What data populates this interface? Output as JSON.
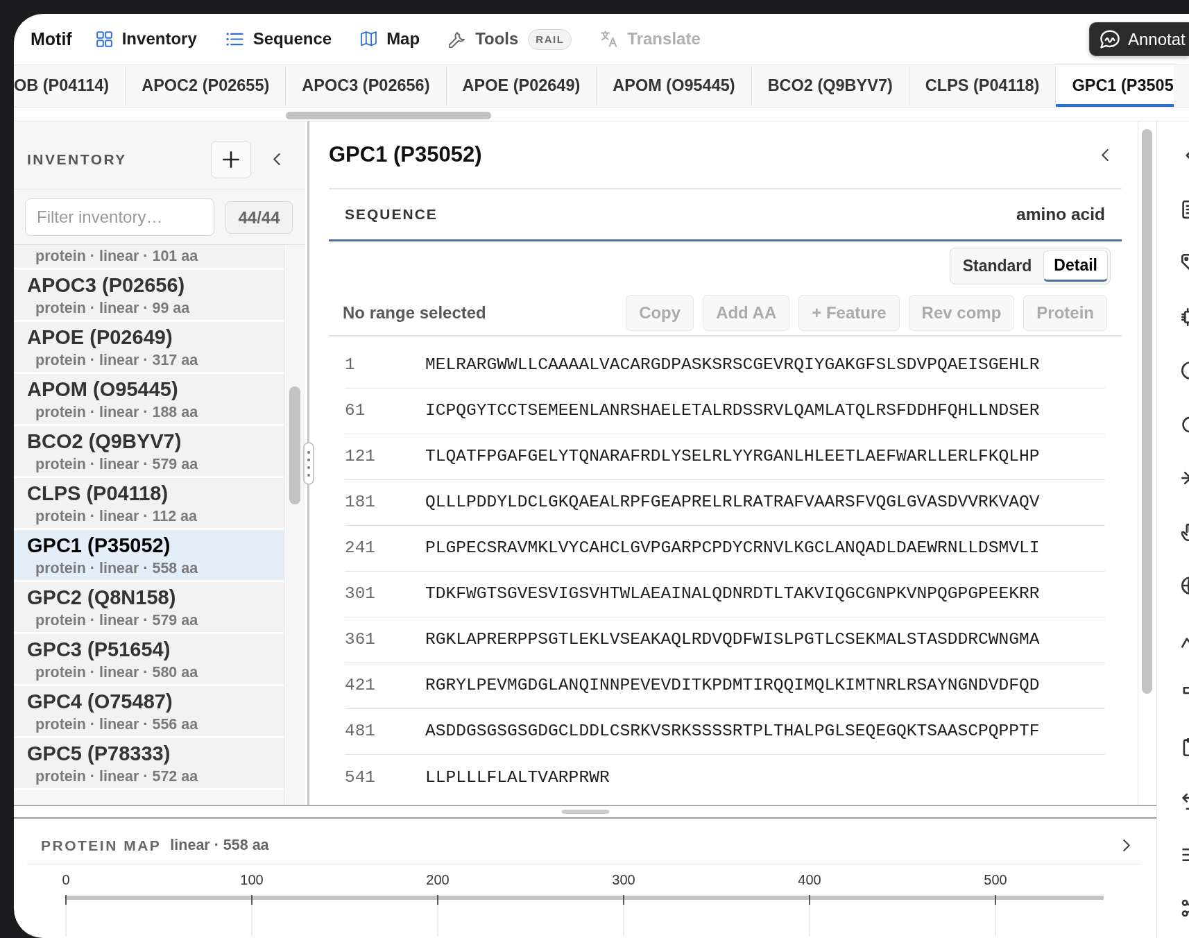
{
  "brand": "Motif",
  "nav": [
    {
      "label": "Inventory",
      "kind": "view",
      "disabled": false
    },
    {
      "label": "Sequence",
      "kind": "view",
      "disabled": false
    },
    {
      "label": "Map",
      "kind": "view",
      "disabled": false
    },
    {
      "label": "Tools",
      "kind": "menu",
      "disabled": false,
      "badge": "RAIL"
    },
    {
      "label": "Translate",
      "kind": "view",
      "disabled": true
    }
  ],
  "annotate_button": {
    "label": "Annotat"
  },
  "tabs": [
    {
      "label": "OB (P04114)",
      "selected": false
    },
    {
      "label": "APOC2 (P02655)",
      "selected": false
    },
    {
      "label": "APOC3 (P02656)",
      "selected": false
    },
    {
      "label": "APOE (P02649)",
      "selected": false
    },
    {
      "label": "APOM (O95445)",
      "selected": false
    },
    {
      "label": "BCO2 (Q9BYV7)",
      "selected": false
    },
    {
      "label": "CLPS (P04118)",
      "selected": false
    },
    {
      "label": "GPC1 (P3505",
      "selected": true
    }
  ],
  "sidebar": {
    "title": "INVENTORY",
    "filter": {
      "placeholder": "Filter inventory…"
    },
    "count": "44/44",
    "items": [
      {
        "meta": "protein · linear · 101 aa",
        "selected": false
      },
      {
        "title": "APOC3 (P02656)",
        "meta": "protein · linear · 99 aa",
        "selected": false
      },
      {
        "title": "APOE (P02649)",
        "meta": "protein · linear · 317 aa",
        "selected": false
      },
      {
        "title": "APOM (O95445)",
        "meta": "protein · linear · 188 aa",
        "selected": false
      },
      {
        "title": "BCO2 (Q9BYV7)",
        "meta": "protein · linear · 579 aa",
        "selected": false
      },
      {
        "title": "CLPS (P04118)",
        "meta": "protein · linear · 112 aa",
        "selected": false
      },
      {
        "title": "GPC1 (P35052)",
        "meta": "protein · linear · 558 aa",
        "selected": true
      },
      {
        "title": "GPC2 (Q8N158)",
        "meta": "protein · linear · 579 aa",
        "selected": false
      },
      {
        "title": "GPC3 (P51654)",
        "meta": "protein · linear · 580 aa",
        "selected": false
      },
      {
        "title": "GPC4 (O75487)",
        "meta": "protein · linear · 556 aa",
        "selected": false
      },
      {
        "title": "GPC5 (P78333)",
        "meta": "protein · linear · 572 aa",
        "selected": false
      }
    ]
  },
  "editor": {
    "title": "GPC1 (P35052)",
    "section": "SEQUENCE",
    "alphabet": "amino acid",
    "views": [
      {
        "label": "Standard",
        "selected": false
      },
      {
        "label": "Detail",
        "selected": true
      }
    ],
    "selection": "No range selected",
    "actions": [
      {
        "label": "Copy",
        "disabled": true
      },
      {
        "label": "Add AA",
        "disabled": true
      },
      {
        "label": "+ Feature",
        "disabled": true
      },
      {
        "label": "Rev comp",
        "disabled": true
      },
      {
        "label": "Protein",
        "disabled": true
      }
    ],
    "rows": [
      {
        "start": "1",
        "residues": "MELRARGWWLLCAAAALVACARGDPASKSRSCGEVRQIYGAKGFSLSDVPQAEISGEHLR"
      },
      {
        "start": "61",
        "residues": "ICPQGYTCCTSEMEENLANRSHAELETALRDSSRVLQAMLATQLRSFDDHFQHLLNDSER"
      },
      {
        "start": "121",
        "residues": "TLQATFPGAFGELYTQNARAFRDLYSELRLYYRGANLHLEETLAEFWARLLERLFKQLHP"
      },
      {
        "start": "181",
        "residues": "QLLLPDDYLDCLGKQAEALRPFGEAPRELRLRATRAFVAARSFVQGLGVASDVVRKVAQV"
      },
      {
        "start": "241",
        "residues": "PLGPECSRAVMKLVYCAHCLGVPGARPCPDYCRNVLKGCLANQADLDAEWRNLLDSMVLI"
      },
      {
        "start": "301",
        "residues": "TDKFWGTSGVESVIGSVHTWLAEAINALQDNRDTLTAKVIQGCGNPKVNPQGPGPEEKRR"
      },
      {
        "start": "361",
        "residues": "RGKLAPRERPPSGTLEKLVSEAKAQLRDVQDFWISLPGTLCSEKMALSTASDDRCWNGMA"
      },
      {
        "start": "421",
        "residues": "RGRYLPEVMGDGLANQINNPEVEVDITKPDMTIRQQIMQLKIMTNRLRSAYNGNDVDFQD"
      },
      {
        "start": "481",
        "residues": "ASDDGSGSGSGDGCLDDLCSRKVSRKSSSSRTPLTHALPGLSEQEGQKTSAASCPQPPTF"
      },
      {
        "start": "541",
        "residues": "LLPLLLFLALTVARPRWR"
      }
    ]
  },
  "protein_map": {
    "title": "PROTEIN MAP",
    "meta": "linear · 558 aa",
    "ticks": [
      "0",
      "100",
      "200",
      "300",
      "400",
      "500"
    ]
  }
}
